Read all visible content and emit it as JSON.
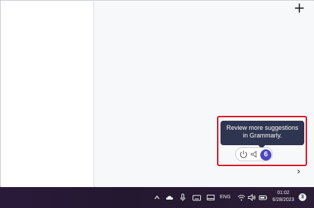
{
  "toolbar": {
    "add_symbol": "+"
  },
  "grammarly": {
    "tooltip_line1": "Review more suggestions",
    "tooltip_line2": "in Grammarly.",
    "suggestion_count": "6",
    "brand_color": "#4b47c2"
  },
  "navigation": {
    "next_symbol": "›"
  },
  "taskbar": {
    "language": "ENG",
    "time": "01:02",
    "date": "6/28/2023",
    "notification_count": "3",
    "tray_icons": [
      "chevron-up-icon",
      "onedrive-cloud-icon",
      "microphone-icon",
      "keyboard-icon",
      "tablet-icon",
      "wifi-icon",
      "speaker-icon",
      "battery-icon"
    ]
  }
}
